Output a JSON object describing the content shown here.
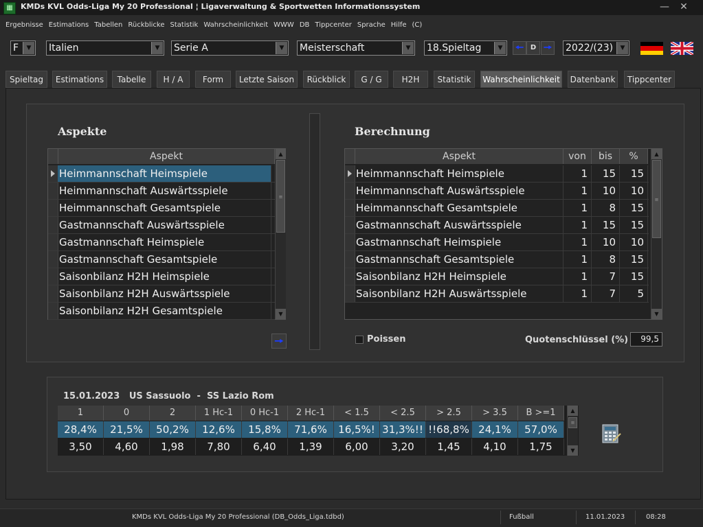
{
  "window": {
    "title": "KMDs KVL Odds-Liga My 20 Professional  ¦  Ligaverwaltung & Sportwetten Informationssystem",
    "minimize": "—",
    "close": "✕"
  },
  "menu": [
    "Ergebnisse",
    "Estimations",
    "Tabellen",
    "Rückblicke",
    "Statistik",
    "Wahrscheinlichkeit",
    "WWW",
    "DB",
    "Tippcenter",
    "Sprache",
    "Hilfe",
    "(C)"
  ],
  "toolbar": {
    "mode": "F",
    "country": "Italien",
    "league": "Serie A",
    "competition": "Meisterschaft",
    "matchday": "18.Spieltag",
    "nav_mid": "D",
    "season": "2022/(23)"
  },
  "tabs": [
    "Spieltag",
    "Estimations",
    "Tabelle",
    "H / A",
    "Form",
    "Letzte Saison",
    "Rückblick",
    "G / G",
    "H2H",
    "Statistik",
    "Wahrscheinlichkeit",
    "Datenbank",
    "Tippcenter"
  ],
  "active_tab": "Wahrscheinlichkeit",
  "aspekte": {
    "title": "Aspekte",
    "header": "Aspekt",
    "items": [
      "Heimmannschaft Heimspiele",
      "Heimmannschaft Auswärtsspiele",
      "Heimmannschaft Gesamtspiele",
      "Gastmannschaft Auswärtsspiele",
      "Gastmannschaft Heimspiele",
      "Gastmannschaft Gesamtspiele",
      "Saisonbilanz H2H Heimspiele",
      "Saisonbilanz H2H Auswärtsspiele",
      "Saisonbilanz H2H Gesamtspiele"
    ]
  },
  "berechnung": {
    "title": "Berechnung",
    "headers": {
      "aspekt": "Aspekt",
      "von": "von",
      "bis": "bis",
      "pct": "%"
    },
    "rows": [
      {
        "aspekt": "Heimmannschaft Heimspiele",
        "von": "1",
        "bis": "15",
        "pct": "15"
      },
      {
        "aspekt": "Heimmannschaft Auswärtsspiele",
        "von": "1",
        "bis": "10",
        "pct": "10"
      },
      {
        "aspekt": "Heimmannschaft Gesamtspiele",
        "von": "1",
        "bis": "8",
        "pct": "15"
      },
      {
        "aspekt": "Gastmannschaft Auswärtsspiele",
        "von": "1",
        "bis": "15",
        "pct": "15"
      },
      {
        "aspekt": "Gastmannschaft Heimspiele",
        "von": "1",
        "bis": "10",
        "pct": "10"
      },
      {
        "aspekt": "Gastmannschaft Gesamtspiele",
        "von": "1",
        "bis": "8",
        "pct": "15"
      },
      {
        "aspekt": "Saisonbilanz H2H Heimspiele",
        "von": "1",
        "bis": "7",
        "pct": "15"
      },
      {
        "aspekt": "Saisonbilanz H2H Auswärtsspiele",
        "von": "1",
        "bis": "7",
        "pct": "5"
      }
    ]
  },
  "poissen_label": "Poissen",
  "quoten": {
    "label": "Quotenschlüssel (%)",
    "value": "99,5"
  },
  "match": {
    "date": "15.01.2023",
    "home": "US Sassuolo",
    "sep": "-",
    "away": "SS Lazio Rom",
    "headers": [
      "1",
      "0",
      "2",
      "1 Hc-1",
      "0 Hc-1",
      "2 Hc-1",
      "< 1.5",
      "< 2.5",
      "> 2.5",
      "> 3.5",
      "B >=1"
    ],
    "probabilities": [
      "28,4%",
      "21,5%",
      "50,2%",
      "12,6%",
      "15,8%",
      "71,6%",
      "16,5%!",
      "31,3%!!",
      "!!68,8%",
      "24,1%",
      "57,0%"
    ],
    "odds": [
      "3,50",
      "4,60",
      "1,98",
      "7,80",
      "6,40",
      "1,39",
      "6,00",
      "3,20",
      "1,45",
      "4,10",
      "1,75"
    ]
  },
  "status": {
    "app": "KMDs KVL Odds-Liga My 20 Professional  (DB_Odds_Liga.tdbd)",
    "sport": "Fußball",
    "date": "11.01.2023",
    "time": "08:28"
  }
}
